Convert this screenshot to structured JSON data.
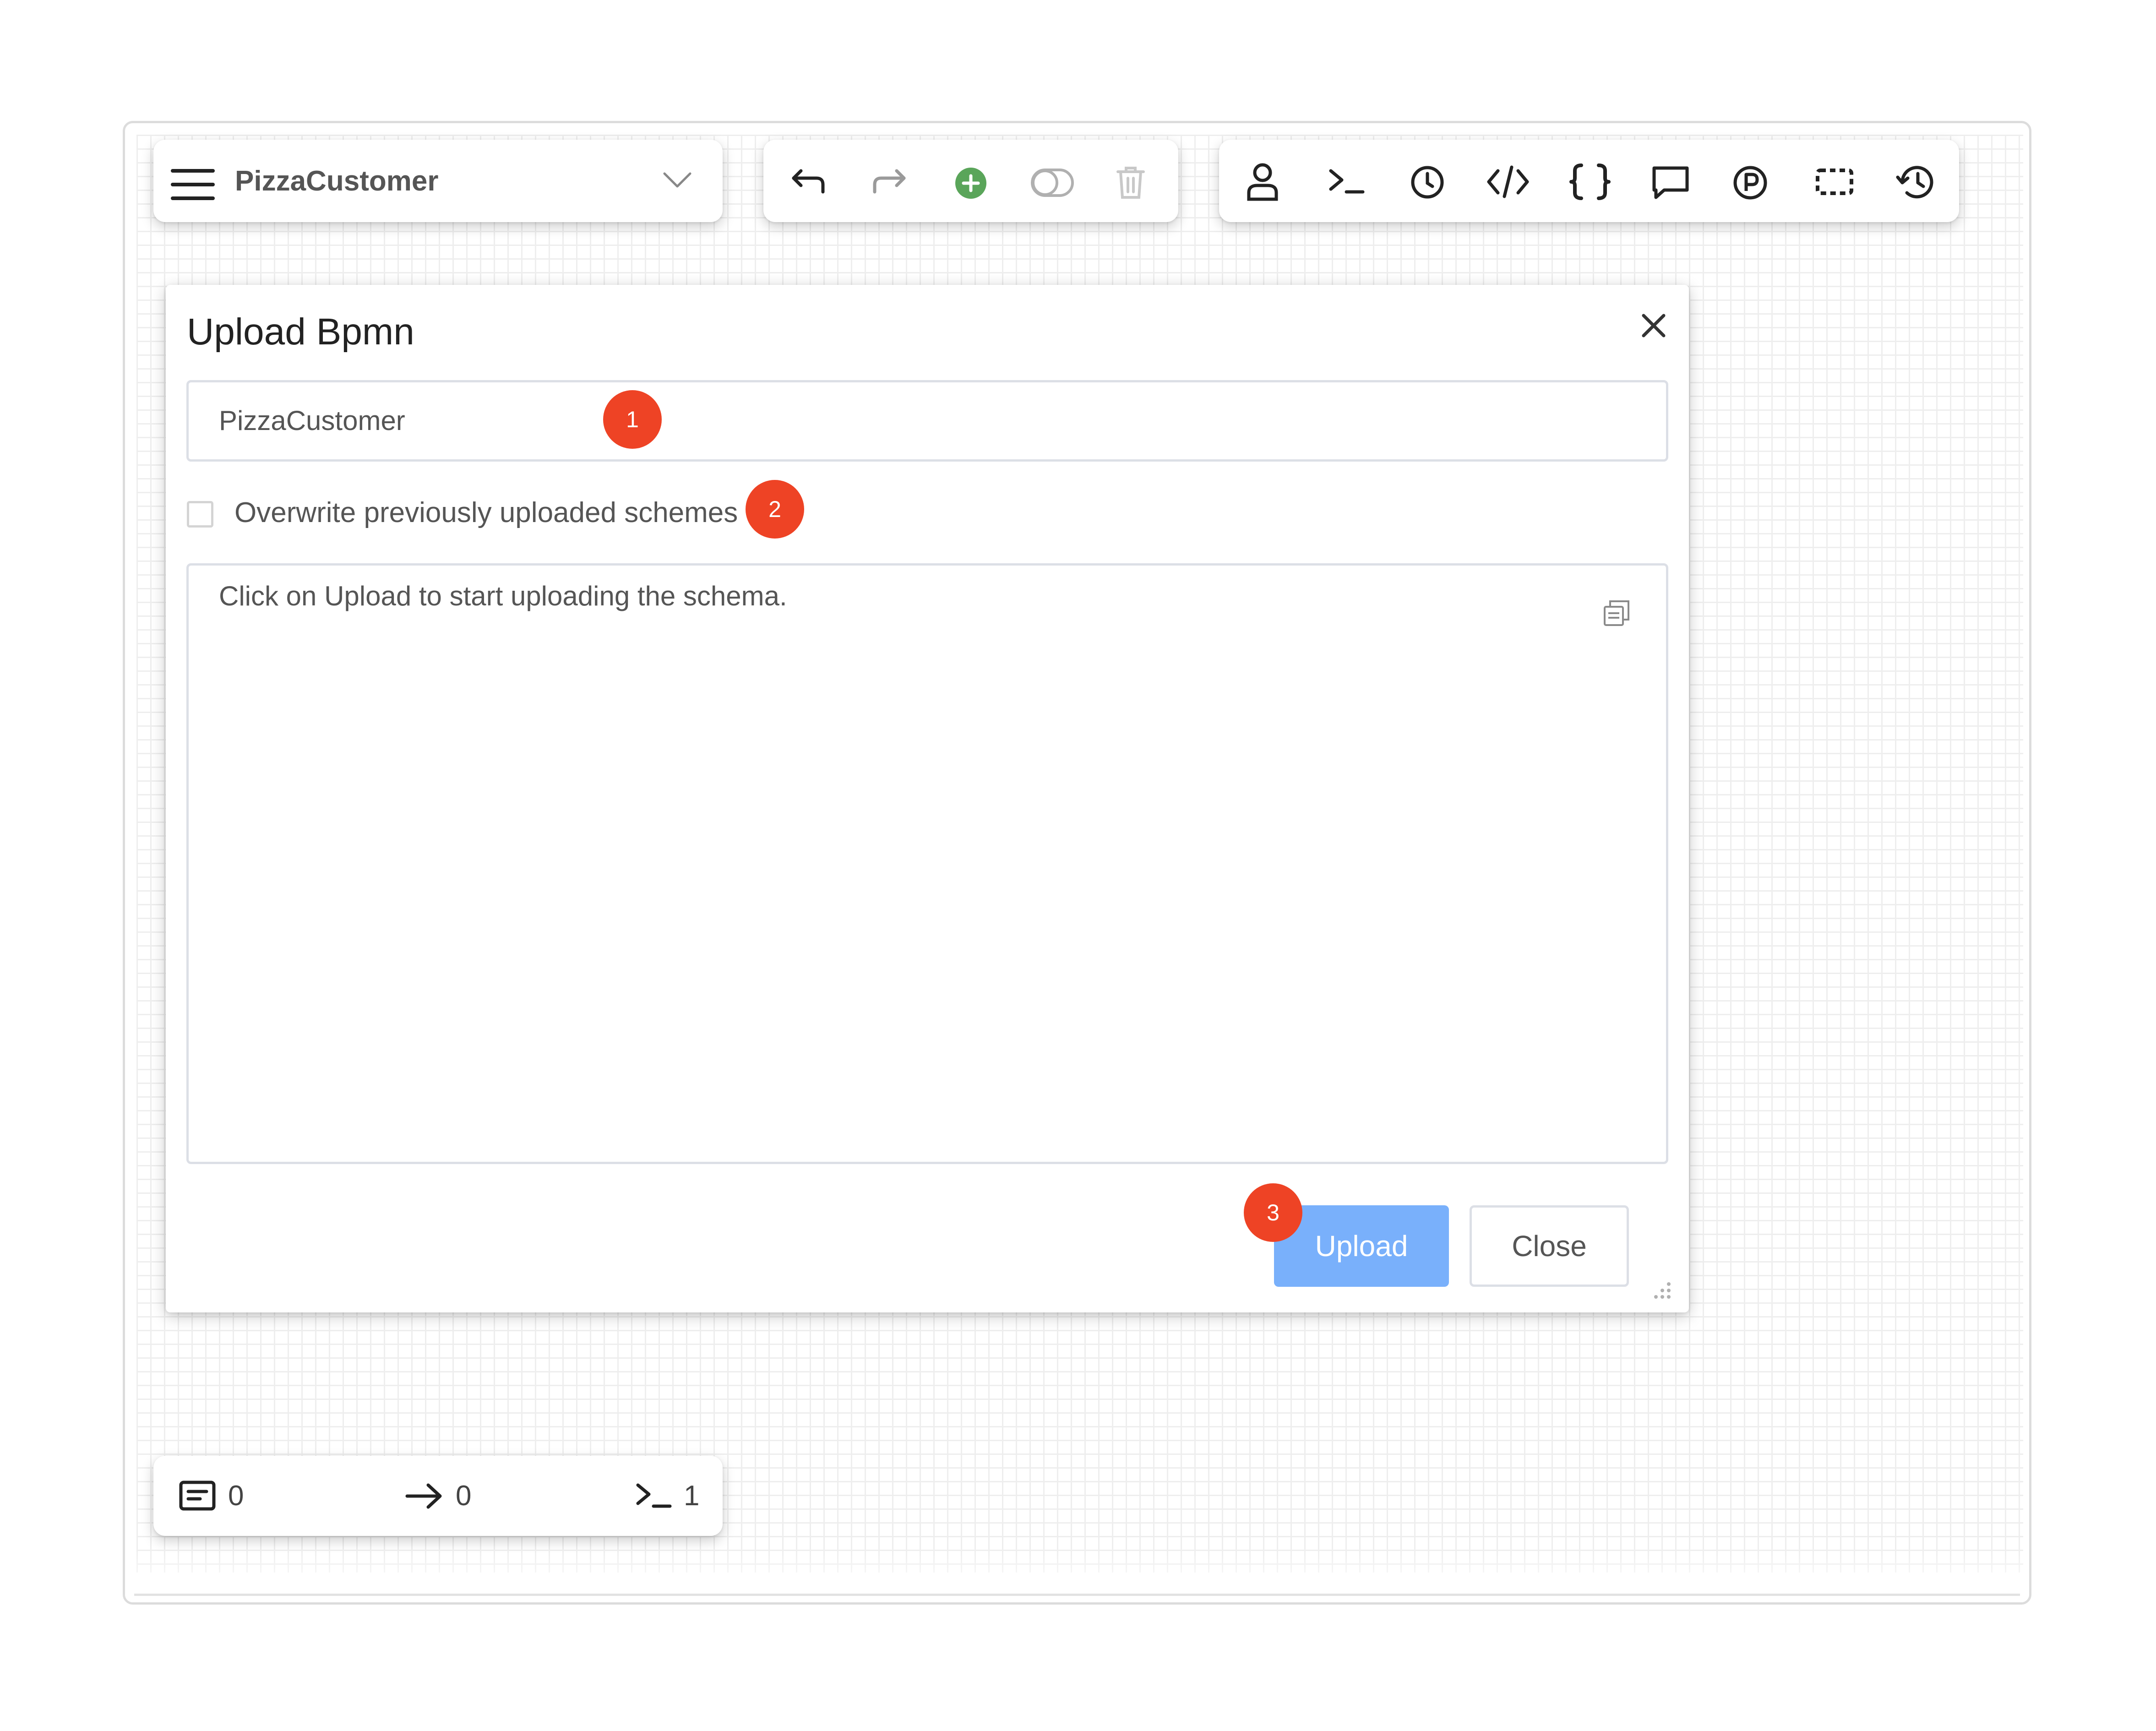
{
  "toolbar_left": {
    "process_name": "PizzaCustomer",
    "menu_icon": "hamburger-menu-icon",
    "dropdown_icon": "chevron-down-icon"
  },
  "toolbar_edit": {
    "icons": [
      "undo-icon",
      "redo-icon",
      "add-circle-icon",
      "toggle-icon",
      "trash-icon"
    ],
    "add_color": "#5aa55a",
    "disabled_color": "#b5b5b5"
  },
  "toolbar_right": {
    "icons": [
      "user-icon",
      "terminal-icon",
      "clock-icon",
      "code-icon",
      "braces-icon",
      "comment-icon",
      "parking-icon",
      "selection-icon",
      "history-icon"
    ]
  },
  "dialog": {
    "title": "Upload Bpmn",
    "name_value": "PizzaCustomer",
    "overwrite_label": "Overwrite previously uploaded schemes",
    "overwrite_checked": false,
    "log_text": "Click on Upload to start uploading the schema.",
    "upload_label": "Upload",
    "close_label": "Close",
    "upload_color": "#79b0fb"
  },
  "badges": [
    "1",
    "2",
    "3"
  ],
  "badge_color": "#ee4325",
  "status_bar": {
    "messages_count": "0",
    "arrows_count": "0",
    "scripts_count": "1"
  }
}
